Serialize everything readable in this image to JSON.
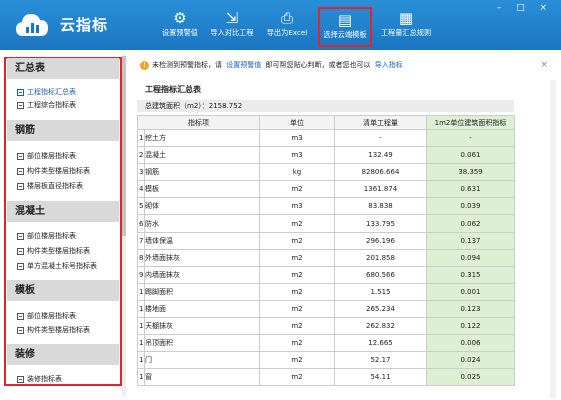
{
  "app": {
    "title": "云指标",
    "win_buttons": "– □ ×"
  },
  "toolbar": [
    {
      "label": "设置预警值",
      "icon": "gear-icon",
      "glyph": "⚙"
    },
    {
      "label": "导入对比工程",
      "icon": "import-icon",
      "glyph": "⇲"
    },
    {
      "label": "导出为Excel",
      "icon": "export-icon",
      "glyph": "⎙"
    },
    {
      "label": "选择云端模板",
      "icon": "template-icon",
      "glyph": "▤"
    },
    {
      "label": "工程量汇总规则",
      "icon": "clipboard-icon",
      "glyph": "▦"
    }
  ],
  "sidebar": {
    "sections": [
      {
        "title": "汇总表",
        "items": [
          "工程指标汇总表",
          "工程综合指标表"
        ]
      },
      {
        "title": "钢筋",
        "items": [
          "部位楼层指标表",
          "构件类型楼层指标表",
          "楼层板直径指标表"
        ]
      },
      {
        "title": "混凝土",
        "items": [
          "部位楼层指标表",
          "构件类型楼层指标表",
          "单方混凝土标号指标表"
        ]
      },
      {
        "title": "模板",
        "items": [
          "部位楼层指标表",
          "构件类型楼层指标表"
        ]
      },
      {
        "title": "装修",
        "items": [
          "装修指标表"
        ]
      }
    ]
  },
  "notice": {
    "text_before": "未检测到预警指标，请",
    "link1": "设置预警值",
    "text_middle": "即可帮您贴心判断，或者您也可以",
    "link2": "导入指标",
    "close": "×"
  },
  "panel": {
    "title": "工程指标汇总表",
    "building_area": "总建筑面积（m2）：2158.752"
  },
  "table": {
    "headers": [
      "指标项",
      "单位",
      "清单工程量",
      "1m2单位建筑面积指标"
    ],
    "rows": [
      {
        "no": "1",
        "name": "挖土方",
        "unit": "m3",
        "qty": "-",
        "index": "-"
      },
      {
        "no": "2",
        "name": "混凝土",
        "unit": "m3",
        "qty": "132.49",
        "index": "0.061"
      },
      {
        "no": "3",
        "name": "钢筋",
        "unit": "kg",
        "qty": "82806.664",
        "index": "38.359"
      },
      {
        "no": "4",
        "name": "模板",
        "unit": "m2",
        "qty": "1361.874",
        "index": "0.631"
      },
      {
        "no": "5",
        "name": "砌体",
        "unit": "m3",
        "qty": "83.838",
        "index": "0.039"
      },
      {
        "no": "6",
        "name": "防水",
        "unit": "m2",
        "qty": "133.795",
        "index": "0.062"
      },
      {
        "no": "7",
        "name": "墙体保温",
        "unit": "m2",
        "qty": "296.196",
        "index": "0.137"
      },
      {
        "no": "8",
        "name": "外墙面抹灰",
        "unit": "m2",
        "qty": "201.858",
        "index": "0.094"
      },
      {
        "no": "9",
        "name": "内墙面抹灰",
        "unit": "m2",
        "qty": "680.566",
        "index": "0.315"
      },
      {
        "no": "10",
        "name": "踢脚面积",
        "unit": "m2",
        "qty": "1.515",
        "index": "0.001"
      },
      {
        "no": "11",
        "name": "楼地面",
        "unit": "m2",
        "qty": "265.234",
        "index": "0.123"
      },
      {
        "no": "12",
        "name": "天棚抹灰",
        "unit": "m2",
        "qty": "262.832",
        "index": "0.122"
      },
      {
        "no": "13",
        "name": "吊顶面积",
        "unit": "m2",
        "qty": "12.665",
        "index": "0.006"
      },
      {
        "no": "14",
        "name": "门",
        "unit": "m2",
        "qty": "52.17",
        "index": "0.024"
      },
      {
        "no": "15",
        "name": "窗",
        "unit": "m2",
        "qty": "54.11",
        "index": "0.025"
      }
    ]
  },
  "colors": {
    "accent": "#1a76c2",
    "highlight": "#e0262c",
    "index_column": "#ddf0d4"
  }
}
